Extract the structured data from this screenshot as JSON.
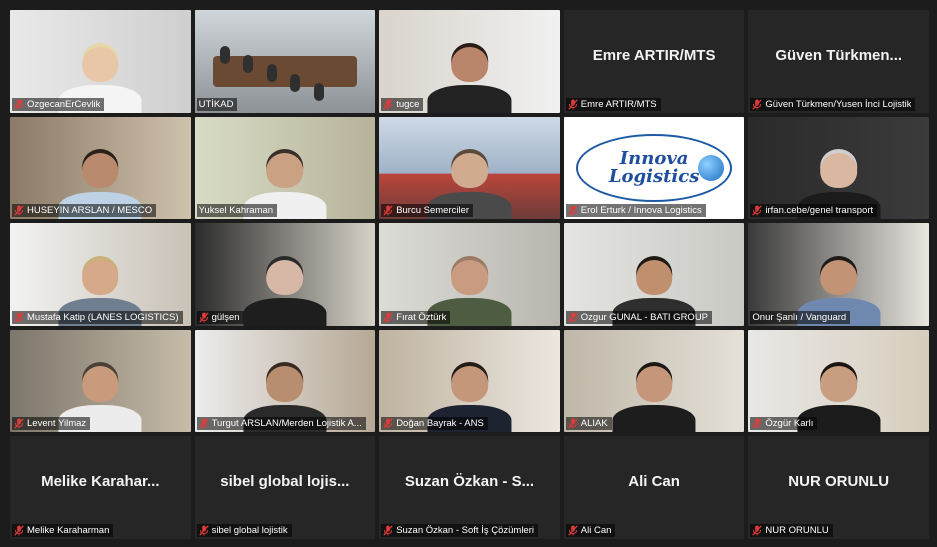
{
  "colors": {
    "active_border": "#e8e24a",
    "muted_mic": "#e03a3a"
  },
  "participants": [
    {
      "label": "OzgecanErCevlik",
      "video": true,
      "muted": true
    },
    {
      "label": "UTİKAD",
      "video": true,
      "muted": false,
      "active": true
    },
    {
      "label": "tugce",
      "video": true,
      "muted": true
    },
    {
      "label": "Emre ARTIR/MTS",
      "display_name": "Emre ARTIR/MTS",
      "video": false,
      "muted": true
    },
    {
      "label": "Güven Türkmen/Yusen İnci Lojistik",
      "display_name": "Güven Türkmen...",
      "video": false,
      "muted": true
    },
    {
      "label": "HUSEYIN ARSLAN / MESCO",
      "video": true,
      "muted": true
    },
    {
      "label": "Yuksel Kahraman",
      "video": true,
      "muted": false
    },
    {
      "label": "Burcu Semerciler",
      "video": true,
      "muted": true
    },
    {
      "label": "Erol Erturk / Innova  Logistics",
      "video": true,
      "muted": true,
      "logo": {
        "line1": "Innova",
        "line2": "Logistics"
      }
    },
    {
      "label": "irfan.cebe/genel transport",
      "video": true,
      "muted": true
    },
    {
      "label": "Mustafa Katip (LANES LOGISTICS)",
      "video": true,
      "muted": true
    },
    {
      "label": "gülşen",
      "video": true,
      "muted": true
    },
    {
      "label": "Fırat Öztürk",
      "video": true,
      "muted": true
    },
    {
      "label": "Ozgur GUNAL - BATI GROUP",
      "video": true,
      "muted": true
    },
    {
      "label": "Onur Şanlı / Vanguard",
      "video": true,
      "muted": false
    },
    {
      "label": "Levent Yilmaz",
      "video": true,
      "muted": true
    },
    {
      "label": "Turgut ARSLAN/Merden Lojistik A...",
      "video": true,
      "muted": true
    },
    {
      "label": "Doğan Bayrak - ANS",
      "video": true,
      "muted": true
    },
    {
      "label": "ALIAK",
      "video": true,
      "muted": true
    },
    {
      "label": "Özgür Karlı",
      "video": true,
      "muted": true
    },
    {
      "label": "Melike Karaharman",
      "display_name": "Melike Karahar...",
      "video": false,
      "muted": true
    },
    {
      "label": "sibel global lojistik",
      "display_name": "sibel global lojis...",
      "video": false,
      "muted": true
    },
    {
      "label": "Suzan Özkan - Soft İş Çözümleri",
      "display_name": "Suzan Özkan - S...",
      "video": false,
      "muted": true
    },
    {
      "label": "Ali Can",
      "display_name": "Ali Can",
      "video": false,
      "muted": true
    },
    {
      "label": "NUR ORUNLU",
      "display_name": "NUR ORUNLU",
      "video": false,
      "muted": true
    }
  ]
}
